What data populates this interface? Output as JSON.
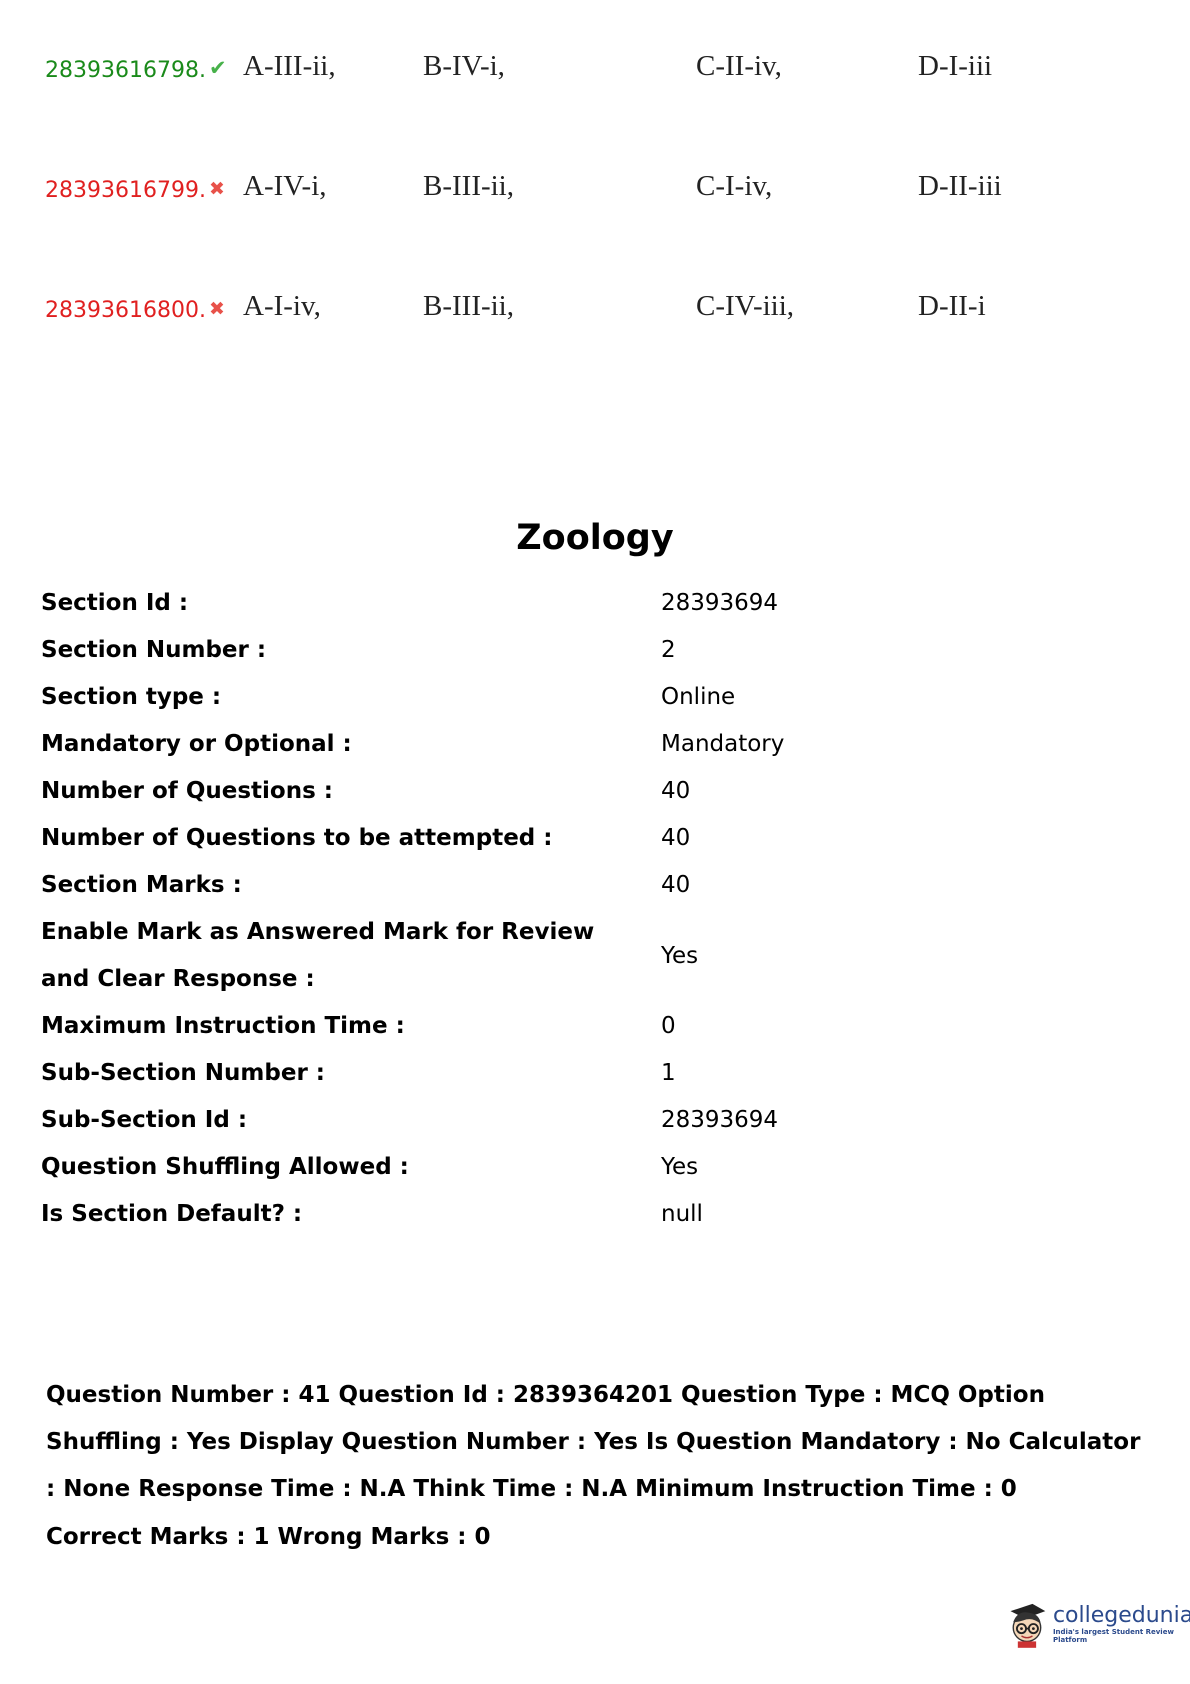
{
  "options": [
    {
      "id": "28393616798.",
      "status": "correct",
      "icon": "check-icon",
      "cells": [
        "A-III-ii,",
        "B-IV-i,",
        "C-II-iv,",
        "D-I-iii"
      ]
    },
    {
      "id": "28393616799.",
      "status": "wrong",
      "icon": "cross-icon",
      "cells": [
        "A-IV-i,",
        "B-III-ii,",
        "C-I-iv,",
        "D-II-iii"
      ]
    },
    {
      "id": "28393616800.",
      "status": "wrong",
      "icon": "cross-icon",
      "cells": [
        "A-I-iv,",
        "B-III-ii,",
        "C-IV-iii,",
        "D-II-i"
      ]
    }
  ],
  "section": {
    "title": "Zoology",
    "rows": [
      {
        "label": "Section Id :",
        "value": "28393694"
      },
      {
        "label": "Section Number :",
        "value": "2"
      },
      {
        "label": "Section type :",
        "value": "Online"
      },
      {
        "label": "Mandatory or Optional :",
        "value": "Mandatory"
      },
      {
        "label": "Number of Questions :",
        "value": "40"
      },
      {
        "label": "Number of Questions to be attempted :",
        "value": "40"
      },
      {
        "label": "Section Marks :",
        "value": "40"
      },
      {
        "label": "Enable Mark as Answered Mark for Review and Clear Response :",
        "value": "Yes"
      },
      {
        "label": "Maximum Instruction Time :",
        "value": "0"
      },
      {
        "label": "Sub-Section Number :",
        "value": "1"
      },
      {
        "label": "Sub-Section Id :",
        "value": "28393694"
      },
      {
        "label": "Question Shuffling Allowed :",
        "value": "Yes"
      },
      {
        "label": "Is Section Default? :",
        "value": "null"
      }
    ]
  },
  "question_meta": "Question Number : 41 Question Id : 2839364201 Question Type : MCQ Option Shuffling : Yes Display Question Number : Yes Is Question Mandatory : No Calculator : None Response Time : N.A Think Time : N.A Minimum Instruction Time : 0",
  "marks_line": "Correct Marks : 1 Wrong Marks : 0",
  "logo": {
    "name": "collegedunia",
    "tagline": "India's largest Student Review Platform",
    "colors": {
      "brand": "#2b4a8c"
    }
  },
  "colors": {
    "correct": "#1a8a1a",
    "wrong": "#e02020"
  }
}
